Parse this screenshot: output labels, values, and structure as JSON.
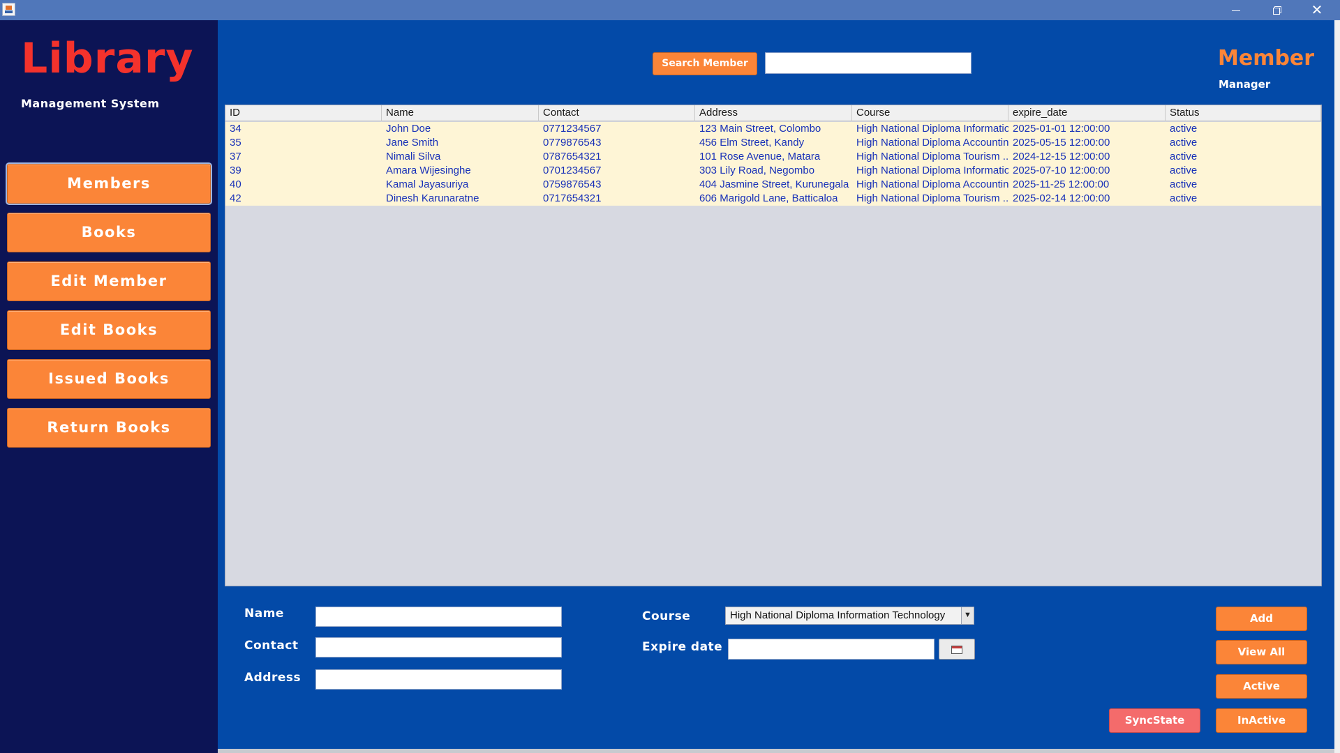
{
  "window": {
    "controls": {
      "minimize": "",
      "maximize": "",
      "close": "✕"
    }
  },
  "sidebar": {
    "brand_title": "Library",
    "brand_subtitle": "Management System",
    "nav": [
      {
        "label": "Members",
        "active": true
      },
      {
        "label": "Books"
      },
      {
        "label": "Edit Member"
      },
      {
        "label": "Edit Books"
      },
      {
        "label": "Issued Books"
      },
      {
        "label": "Return Books"
      }
    ]
  },
  "header": {
    "search_button": "Search Member",
    "search_value": "",
    "title": "Member",
    "subtitle": "Manager"
  },
  "table": {
    "columns": [
      "ID",
      "Name",
      "Contact",
      "Address",
      "Course",
      "expire_date",
      "Status"
    ],
    "rows": [
      [
        "34",
        "John Doe",
        "0771234567",
        "123 Main Street, Colombo",
        "High National Diploma Informatio...",
        "2025-01-01 12:00:00",
        "active"
      ],
      [
        "35",
        "Jane Smith",
        "0779876543",
        "456 Elm Street, Kandy",
        "High National Diploma Accountin...",
        "2025-05-15 12:00:00",
        "active"
      ],
      [
        "37",
        "Nimali Silva",
        "0787654321",
        "101 Rose Avenue, Matara",
        "High National Diploma Tourism ...",
        "2024-12-15 12:00:00",
        "active"
      ],
      [
        "39",
        "Amara Wijesinghe",
        "0701234567",
        "303 Lily Road, Negombo",
        "High National Diploma Informatio...",
        "2025-07-10 12:00:00",
        "active"
      ],
      [
        "40",
        "Kamal Jayasuriya",
        "0759876543",
        "404 Jasmine Street, Kurunegala",
        "High National Diploma Accountin...",
        "2025-11-25 12:00:00",
        "active"
      ],
      [
        "42",
        "Dinesh Karunaratne",
        "0717654321",
        "606 Marigold Lane, Batticaloa",
        "High National Diploma Tourism ...",
        "2025-02-14 12:00:00",
        "active"
      ]
    ]
  },
  "form": {
    "name_label": "Name",
    "name_value": "",
    "contact_label": "Contact",
    "contact_value": "",
    "address_label": "Address",
    "address_value": "",
    "course_label": "Course",
    "course_selected": "High National Diploma Information Technology",
    "expire_label": "Expire date",
    "expire_value": ""
  },
  "actions": {
    "add": "Add",
    "view_all": "View All",
    "active": "Active",
    "inactive": "InActive",
    "sync": "SyncState"
  },
  "icons": {
    "app": "java-cup-icon",
    "calendar": "calendar-icon",
    "dropdown": "chevron-down-icon"
  },
  "colors": {
    "sidebar_bg": "#0c1455",
    "main_bg": "#034aa8",
    "accent": "#fb8538",
    "brand_red": "#f4322c",
    "row_bg": "#fef5d6",
    "row_text": "#1830b8",
    "sync_button": "#f46b6b"
  }
}
